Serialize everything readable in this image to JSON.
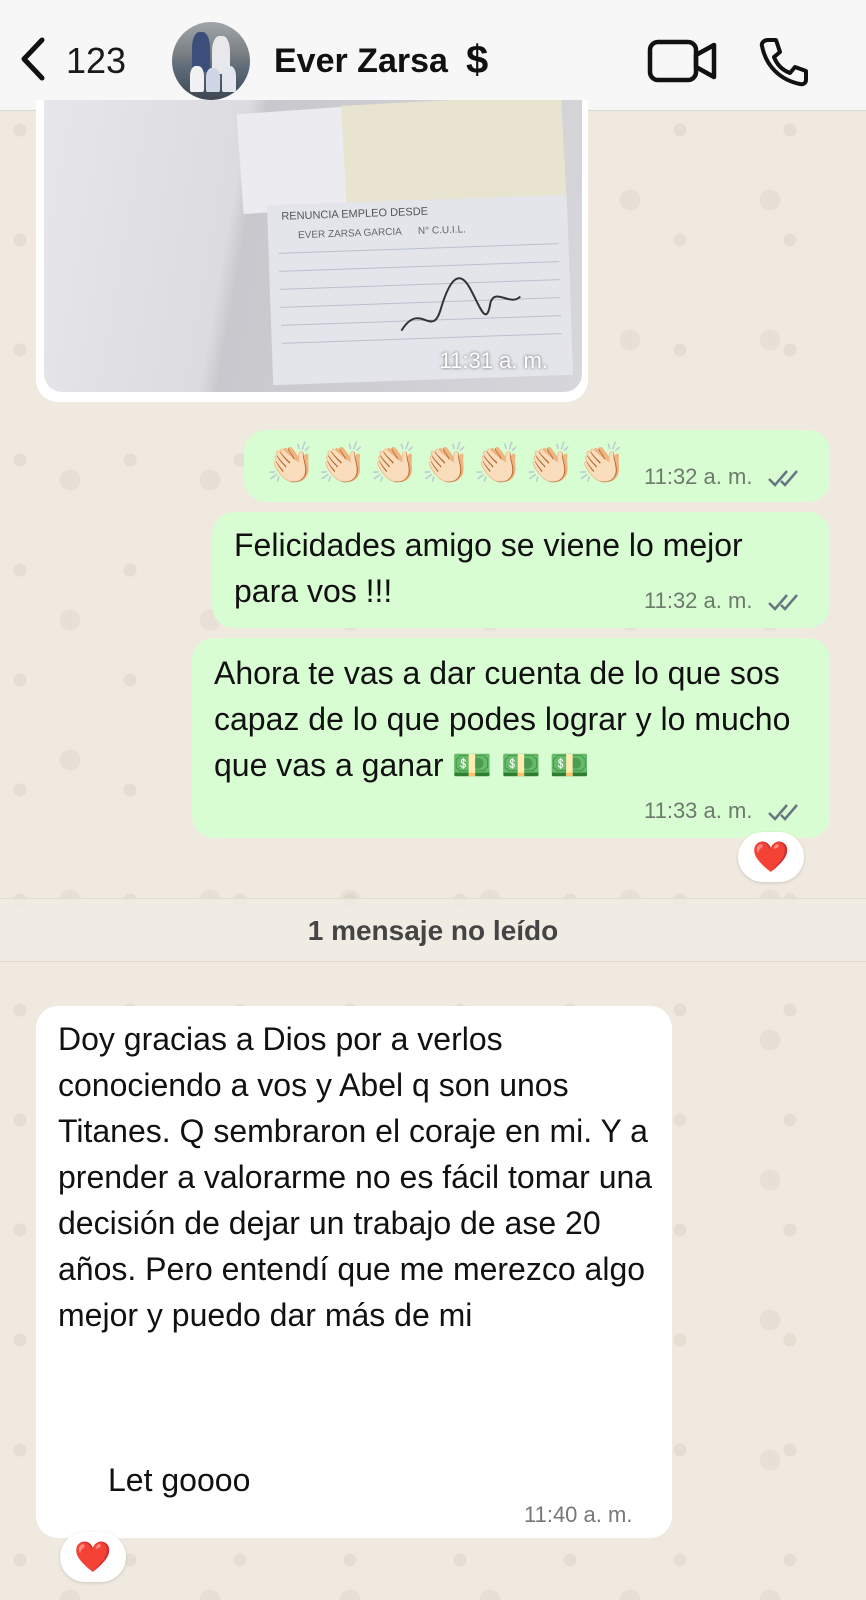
{
  "header": {
    "back_count": "123",
    "contact_name": "Ever Zarsa",
    "name_badge": "$"
  },
  "messages": [
    {
      "type": "image",
      "direction": "in",
      "image_text": [
        "RENUNCIA",
        "EMPLEO DESDE",
        "EVER ZARSA GARCIA",
        "N° C.U.I.L."
      ],
      "time": "11:31 a. m."
    },
    {
      "type": "text",
      "direction": "out",
      "text": "👏🏻👏🏻👏🏻👏🏻👏🏻👏🏻👏🏻",
      "time": "11:32 a. m.",
      "status": "read"
    },
    {
      "type": "text",
      "direction": "out",
      "text": "Felicidades amigo se viene lo mejor para vos !!!",
      "time": "11:32 a. m.",
      "status": "read"
    },
    {
      "type": "text",
      "direction": "out",
      "text": "Ahora te vas a dar cuenta de lo que sos capaz de lo que podes lograr y lo mucho que vas a ganar 💵 💵 💵",
      "time": "11:33 a. m.",
      "status": "read",
      "reaction": "❤️"
    },
    {
      "type": "text",
      "direction": "in",
      "text": "Doy gracias a Dios por a verlos conociendo a vos y Abel q son unos Titanes. Q sembraron el coraje en mi. Y a prender a valorarme  no es fácil tomar una decisión de dejar un trabajo de ase 20 años. Pero entendí que me merezco algo mejor y puedo dar más de mi",
      "tail": "Let  goooo",
      "time": "11:40 a. m.",
      "reaction": "❤️"
    }
  ],
  "unread_banner": "1 mensaje no leído",
  "colors": {
    "outgoing_bubble": "#d9fdd3",
    "incoming_bubble": "#ffffff",
    "wallpaper": "#efe9e0",
    "read_ticks": "#667781"
  },
  "icons": [
    "back-chevron-icon",
    "avatar",
    "video-call-icon",
    "phone-call-icon",
    "double-check-icon",
    "heart-reaction"
  ]
}
